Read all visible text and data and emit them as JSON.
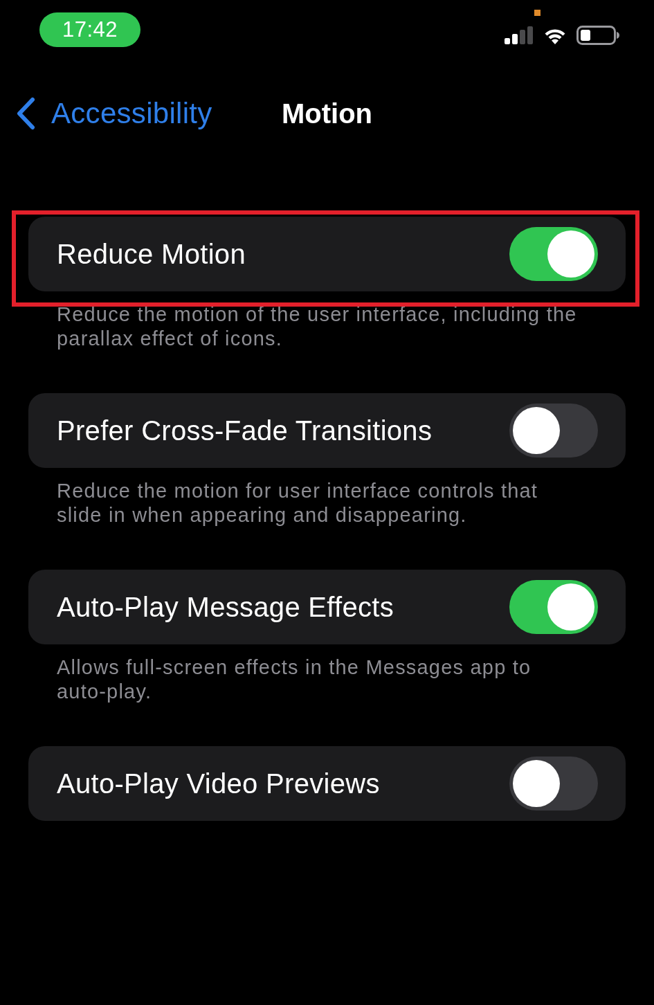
{
  "status_bar": {
    "time": "17:42"
  },
  "nav": {
    "back_label": "Accessibility",
    "title": "Motion"
  },
  "settings": [
    {
      "label": "Reduce Motion",
      "on": true,
      "highlighted": true,
      "description": "Reduce the motion of the user interface, including the parallax effect of icons."
    },
    {
      "label": "Prefer Cross-Fade Transitions",
      "on": false,
      "highlighted": false,
      "description": "Reduce the motion for user interface controls that slide in when appearing and disappearing."
    },
    {
      "label": "Auto-Play Message Effects",
      "on": true,
      "highlighted": false,
      "description": "Allows full-screen effects in the Messages app to auto-play."
    },
    {
      "label": "Auto-Play Video Previews",
      "on": false,
      "highlighted": false
    }
  ]
}
